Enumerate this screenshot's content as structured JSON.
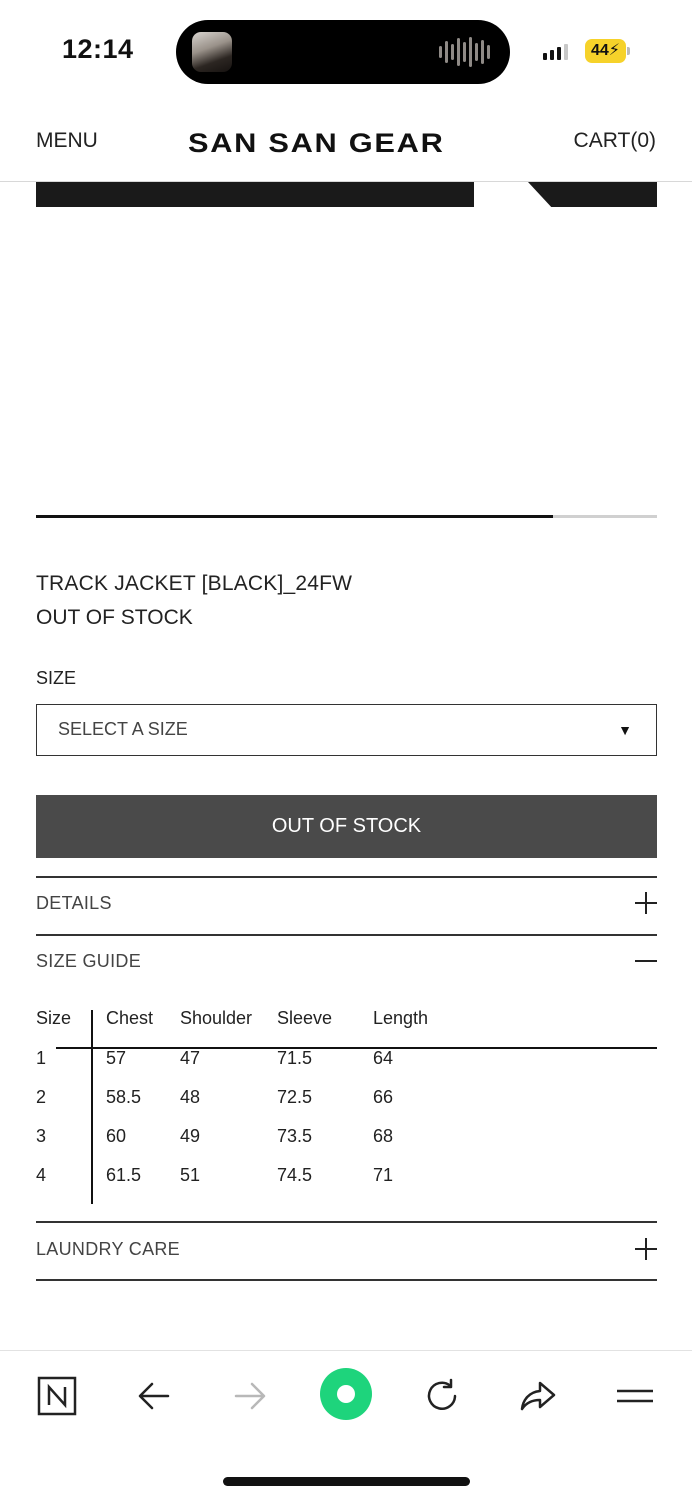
{
  "status_bar": {
    "time": "12:14",
    "battery": "44"
  },
  "header": {
    "menu_label": "MENU",
    "brand": "SAN SAN GEAR",
    "cart_label": "CART(0)"
  },
  "gallery": {
    "progress_fraction": 0.833
  },
  "product": {
    "name": "TRACK JACKET [BLACK]_24FW",
    "stock_status": "OUT OF STOCK",
    "size_label": "SIZE",
    "size_select_placeholder": "SELECT A SIZE",
    "size_select_arrow": "▼",
    "action_button": "OUT OF STOCK"
  },
  "accordions": {
    "details": {
      "label": "DETAILS",
      "expanded": false
    },
    "size_guide": {
      "label": "SIZE GUIDE",
      "expanded": true
    },
    "laundry_care": {
      "label": "LAUNDRY CARE",
      "expanded": false
    }
  },
  "size_guide_table": {
    "headers": [
      "Size",
      "Chest",
      "Shoulder",
      "Sleeve",
      "Length"
    ],
    "rows": [
      [
        "1",
        "57",
        "47",
        "71.5",
        "64"
      ],
      [
        "2",
        "58.5",
        "48",
        "72.5",
        "66"
      ],
      [
        "3",
        "60",
        "49",
        "73.5",
        "68"
      ],
      [
        "4",
        "61.5",
        "51",
        "74.5",
        "71"
      ]
    ]
  },
  "browser_toolbar": {
    "icons": [
      "naver-icon",
      "back-arrow-icon",
      "forward-arrow-icon",
      "green-dot-icon",
      "reload-icon",
      "share-icon",
      "hamburger-menu-icon"
    ],
    "accent_color": "#1ed47c"
  }
}
